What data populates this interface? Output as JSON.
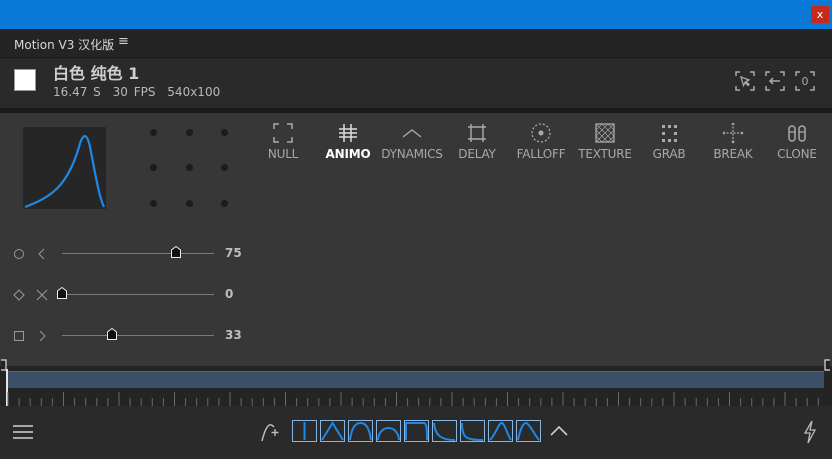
{
  "window": {
    "close_label": "x"
  },
  "panel": {
    "title": "Motion V3 汉化版",
    "menu_icon": "≡"
  },
  "layer": {
    "name": "白色 纯色 1",
    "duration": "16.47 S",
    "fps": "30 FPS",
    "size": "540x100",
    "swatch_color": "#ffffff"
  },
  "header_icons": [
    "select-cursor-icon",
    "back-arrow-icon",
    "zero-bracket-icon"
  ],
  "header_zero_label": "0",
  "tools": [
    {
      "label": "NULL",
      "icon": "null-icon"
    },
    {
      "label": "ANIMO",
      "icon": "animo-icon",
      "active": true
    },
    {
      "label": "DYNAMICS",
      "icon": "dynamics-icon"
    },
    {
      "label": "DELAY",
      "icon": "delay-icon"
    },
    {
      "label": "FALLOFF",
      "icon": "falloff-icon"
    },
    {
      "label": "TEXTURE",
      "icon": "texture-icon"
    },
    {
      "label": "GRAB",
      "icon": "grab-icon"
    },
    {
      "label": "BREAK",
      "icon": "break-icon"
    },
    {
      "label": "CLONE",
      "icon": "clone-icon"
    }
  ],
  "sliders": [
    {
      "icons": [
        "circle-icon",
        "chevron-left-icon"
      ],
      "value": "75",
      "level": 0.75
    },
    {
      "icons": [
        "diamond-icon",
        "cross-icon"
      ],
      "value": "0",
      "level": 0.0
    },
    {
      "icons": [
        "square-icon",
        "chevron-right-icon"
      ],
      "value": "33",
      "level": 0.33
    }
  ],
  "ease_presets": [
    "linear",
    "ease-in-out",
    "ease-in-out-strong",
    "ease-out",
    "ease-out-strong",
    "ease-in",
    "ease-in-strong",
    "overshoot",
    "anticipate"
  ],
  "colors": {
    "accent": "#1e88e5",
    "titlebar": "#0a78d7"
  }
}
